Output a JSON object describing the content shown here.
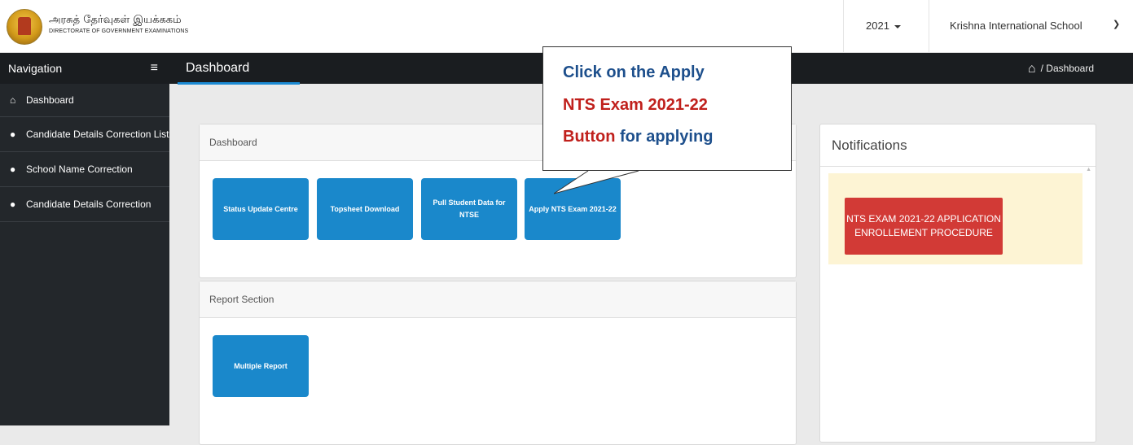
{
  "topbar": {
    "org_name_tamil": "அரசுத் தேர்வுகள் இயக்ககம்",
    "org_name_english": "DIRECTORATE OF GOVERNMENT EXAMINATIONS",
    "year_select": "2021",
    "school_select": "Krishna International School"
  },
  "sidebar": {
    "heading": "Navigation",
    "items": [
      {
        "icon": "home-icon",
        "label": "Dashboard"
      },
      {
        "icon": "user-icon",
        "label": "Candidate Details Correction List"
      },
      {
        "icon": "user-icon",
        "label": "School Name Correction"
      },
      {
        "icon": "user-icon",
        "label": "Candidate Details Correction"
      }
    ]
  },
  "header": {
    "title": "Dashboard",
    "breadcrumb_current": "Dashboard",
    "breadcrumb_separator": "/"
  },
  "dashboard_panel": {
    "title": "Dashboard",
    "tiles": [
      "Status Update Centre",
      "Topsheet Download",
      "Pull Student Data for NTSE",
      "Apply NTS Exam 2021-22"
    ]
  },
  "report_panel": {
    "title": "Report Section",
    "tiles": [
      "Multiple Report"
    ]
  },
  "notifications": {
    "title": "Notifications",
    "button_label": "NTS EXAM 2021-22 APPLICATION ENROLLEMENT PROCEDURE"
  },
  "callout": {
    "line1": "Click on the Apply",
    "line2": "NTS Exam 2021-22",
    "line3_red": "Button",
    "line3_blue": " for applying"
  },
  "colors": {
    "tile_blue": "#1a88cb",
    "notif_red": "#d23a36",
    "notif_bg": "#fdf4d4",
    "sidebar_bg": "#23272b",
    "accent": "#1b8ad3"
  }
}
